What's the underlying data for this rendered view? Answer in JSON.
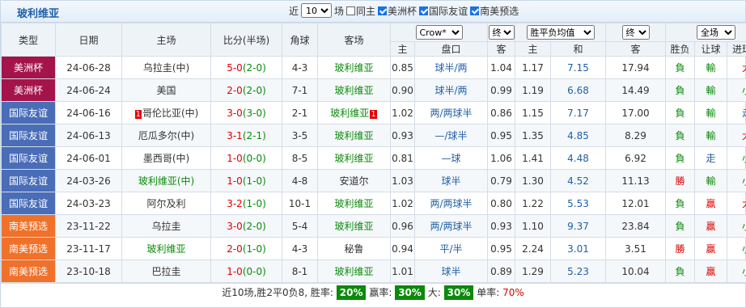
{
  "team": "玻利维亚",
  "filter": {
    "recent_label": "近",
    "count_value": "10",
    "matches_label": "场",
    "checks": [
      {
        "label": "同主",
        "checked": false
      },
      {
        "label": "美洲杯",
        "checked": true
      },
      {
        "label": "国际友谊",
        "checked": true
      },
      {
        "label": "南美预选",
        "checked": true
      }
    ]
  },
  "headers": {
    "type": "类型",
    "date": "日期",
    "home": "主场",
    "score": "比分(半场)",
    "corner": "角球",
    "away": "客场",
    "company": "Crow*",
    "stage1": "终",
    "odds_type": "胜平负均值",
    "stage2": "终",
    "scope": "全场",
    "sub": {
      "h_main": "主",
      "h_line": "盘口",
      "h_away": "客",
      "o_main": "主",
      "o_draw": "和",
      "o_away": "客",
      "wl": "胜负",
      "handicap": "让球",
      "ou": "进球数"
    }
  },
  "colors": {
    "copa": "#a4144b",
    "friendly": "#4a6db7",
    "qual": "#f0712a",
    "draw_red": "#d00",
    "win_green": "#0a8a0a"
  },
  "rows": [
    {
      "type": "美洲杯",
      "cat": "copa",
      "date": "24-06-28",
      "home": "乌拉圭(中)",
      "score": "5-0",
      "half": "(2-0)",
      "corner": "4-3",
      "away": "玻利维亚",
      "a1": "0.85",
      "line": "球半/两",
      "a2": "1.04",
      "o1": "1.17",
      "o2": "7.15",
      "o3": "17.94",
      "wl": "負",
      "hc": "輸",
      "ou": "大"
    },
    {
      "type": "美洲杯",
      "cat": "copa",
      "date": "24-06-24",
      "home": "美国",
      "score": "2-0",
      "half": "(2-0)",
      "corner": "7-1",
      "away": "玻利维亚",
      "a1": "0.90",
      "line": "球半/两",
      "a2": "0.99",
      "o1": "1.19",
      "o2": "6.68",
      "o3": "14.49",
      "wl": "負",
      "hc": "輸",
      "ou": "小"
    },
    {
      "type": "国际友谊",
      "cat": "friendly",
      "date": "24-06-16",
      "home_rank": "1",
      "home": "哥伦比亚(中)",
      "score": "3-0",
      "half": "(3-0)",
      "corner": "2-1",
      "away": "玻利维亚",
      "away_rank": "1",
      "a1": "1.02",
      "line": "两/两球半",
      "a2": "0.86",
      "o1": "1.15",
      "o2": "7.17",
      "o3": "17.00",
      "wl": "負",
      "hc": "輸",
      "ou": "走"
    },
    {
      "type": "国际友谊",
      "cat": "friendly",
      "date": "24-06-13",
      "home": "厄瓜多尔(中)",
      "score": "3-1",
      "half": "(2-1)",
      "corner": "3-5",
      "away": "玻利维亚",
      "a1": "0.93",
      "line": "—/球半",
      "a2": "0.95",
      "o1": "1.35",
      "o2": "4.85",
      "o3": "8.29",
      "wl": "負",
      "hc": "輸",
      "ou": "大"
    },
    {
      "type": "国际友谊",
      "cat": "friendly",
      "date": "24-06-01",
      "home": "墨西哥(中)",
      "score": "1-0",
      "half": "(0-0)",
      "corner": "8-5",
      "away": "玻利维亚",
      "a1": "0.81",
      "line": "—球",
      "a2": "1.06",
      "o1": "1.41",
      "o2": "4.48",
      "o3": "6.92",
      "wl": "負",
      "hc": "走",
      "ou": "小"
    },
    {
      "type": "国际友谊",
      "cat": "friendly",
      "date": "24-03-26",
      "home": "玻利维亚(中)",
      "home_green": true,
      "score": "1-0",
      "half": "(1-0)",
      "corner": "4-8",
      "away": "安道尔",
      "away_plain": true,
      "a1": "1.03",
      "line": "球半",
      "a2": "0.79",
      "o1": "1.30",
      "o2": "4.52",
      "o3": "11.13",
      "wl": "勝",
      "hc": "輸",
      "ou": "小"
    },
    {
      "type": "国际友谊",
      "cat": "friendly",
      "date": "24-03-23",
      "home": "阿尔及利",
      "score": "3-2",
      "half": "(1-0)",
      "corner": "10-1",
      "away": "玻利维亚",
      "a1": "1.02",
      "line": "两/两球半",
      "a2": "0.80",
      "o1": "1.22",
      "o2": "5.53",
      "o3": "12.01",
      "wl": "負",
      "hc": "贏",
      "ou": "大"
    },
    {
      "type": "南美预选",
      "cat": "qual",
      "date": "23-11-22",
      "home": "乌拉圭",
      "score": "3-0",
      "half": "(2-0)",
      "corner": "5-4",
      "away": "玻利维亚",
      "a1": "0.96",
      "line": "两/两球半",
      "a2": "0.93",
      "o1": "1.10",
      "o2": "9.37",
      "o3": "23.84",
      "wl": "負",
      "hc": "贏",
      "ou": "小"
    },
    {
      "type": "南美预选",
      "cat": "qual",
      "date": "23-11-17",
      "home": "玻利维亚",
      "home_green": true,
      "score": "2-0",
      "half": "(1-0)",
      "corner": "4-3",
      "away": "秘鲁",
      "away_plain": true,
      "a1": "0.94",
      "line": "平/半",
      "a2": "0.95",
      "o1": "2.24",
      "o2": "3.01",
      "o3": "3.51",
      "wl": "勝",
      "hc": "贏",
      "ou": "小"
    },
    {
      "type": "南美预选",
      "cat": "qual",
      "date": "23-10-18",
      "home": "巴拉圭",
      "score": "1-0",
      "half": "(0-0)",
      "corner": "8-1",
      "away": "玻利维亚",
      "a1": "1.01",
      "line": "球半",
      "a2": "0.89",
      "o1": "1.29",
      "o2": "5.23",
      "o3": "10.04",
      "wl": "負",
      "hc": "贏",
      "ou": "小"
    }
  ],
  "footer": {
    "summary": "近10场,胜2平0负8, 胜率:",
    "win_rate": "20%",
    "cover_label": "赢率:",
    "cover_rate": "30%",
    "big_label": "大:",
    "big_rate": "30%",
    "odd_label": "单率:",
    "odd_rate": "70%"
  }
}
